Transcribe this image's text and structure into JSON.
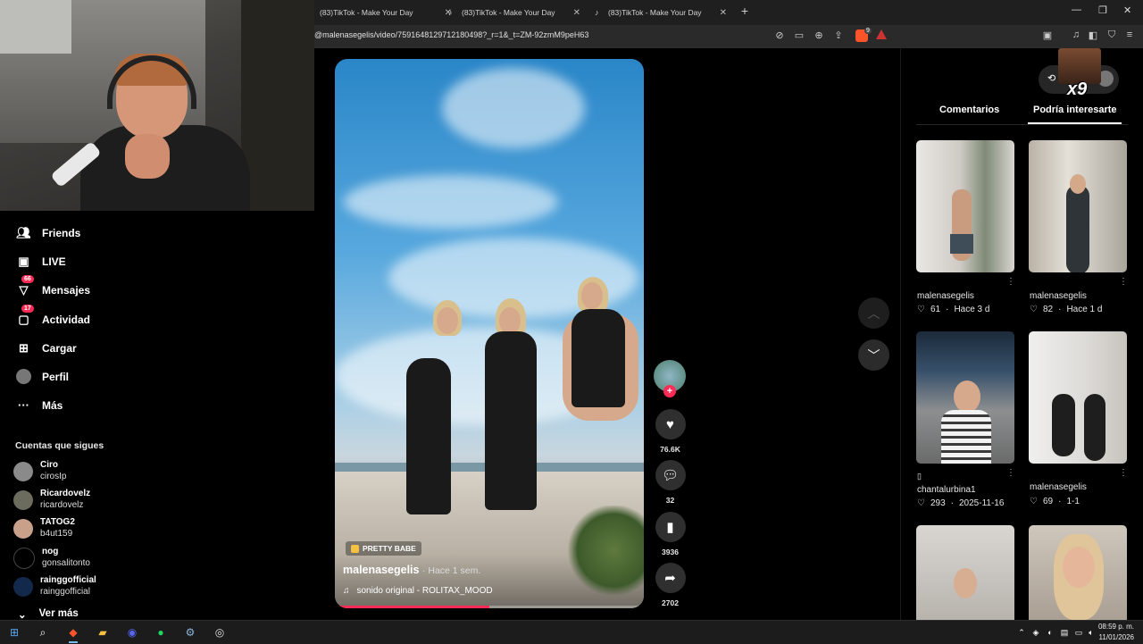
{
  "browser": {
    "tabs": [
      {
        "title": "(83)TikTok - Make Your Day"
      },
      {
        "title": "(83)TikTok - Make Your Day"
      },
      {
        "title": "(83)TikTok - Make Your Day"
      }
    ],
    "url": "@malenasegelis/video/7591648129712180498?_r=1&_t=ZM-92zmM9peH63",
    "shield_badge": "9"
  },
  "sidebar": {
    "nav": [
      {
        "label": "Friends",
        "icon": "friends-icon"
      },
      {
        "label": "LIVE",
        "icon": "live-icon"
      },
      {
        "label": "Mensajes",
        "icon": "messages-icon",
        "badge": "66"
      },
      {
        "label": "Actividad",
        "icon": "activity-icon",
        "badge": "17"
      },
      {
        "label": "Cargar",
        "icon": "upload-icon"
      },
      {
        "label": "Perfil",
        "icon": "profile-icon"
      },
      {
        "label": "Más",
        "icon": "more-icon"
      }
    ],
    "following_title": "Cuentas que sigues",
    "following": [
      {
        "name": "Ciro",
        "handle": "cirosIp"
      },
      {
        "name": "Ricardovelz",
        "handle": "ricardovelz"
      },
      {
        "name": "TATOG2",
        "handle": "b4ut159"
      },
      {
        "name": "nog",
        "handle": "gonsalitonto"
      },
      {
        "name": "rainggofficial",
        "handle": "rainggofficial"
      }
    ],
    "see_more": "Ver más"
  },
  "video": {
    "tag": "PRETTY BABE",
    "author": "malenasegelis",
    "time": "· Hace 1 sem.",
    "music": "sonido original - ROLITAX_MOOD",
    "progress": 0.5
  },
  "actions": {
    "likes": "76.6K",
    "comments": "32",
    "saves": "3936",
    "shares": "2702"
  },
  "right_panel": {
    "tab_comments": "Comentarios",
    "tab_suggested": "Podría interesarte",
    "overlay_text": "x9",
    "thumbs": [
      {
        "author": "malenasegelis",
        "likes": "61",
        "date": "Hace 3 d",
        "caption": ""
      },
      {
        "author": "malenasegelis",
        "likes": "82",
        "date": "Hace 1 d",
        "caption": ""
      },
      {
        "author": "chantalurbina1",
        "likes": "293",
        "date": "2025-11-16",
        "caption": "▯"
      },
      {
        "author": "malenasegelis",
        "likes": "69",
        "date": "1-1",
        "caption": ""
      }
    ]
  },
  "taskbar": {
    "time": "08:59 p. m.",
    "date": "11/01/2026"
  }
}
